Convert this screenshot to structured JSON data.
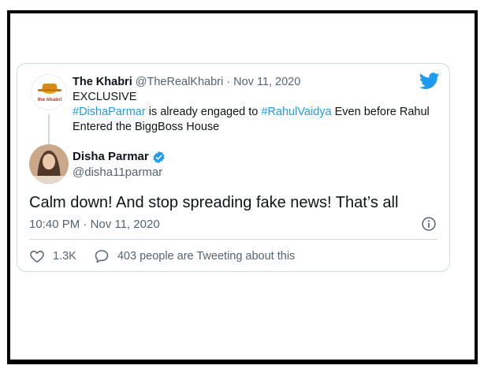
{
  "quoted_tweet": {
    "avatar_text": "the khabri",
    "author_name": "The Khabri",
    "author_handle": "@TheRealKhabri",
    "date": "Nov 11, 2020",
    "line1": "EXCLUSIVE",
    "hashtag1": "#DishaParmar",
    "middle_text": " is already engaged to ",
    "hashtag2": "#RahulVaidya",
    "end_text": " Even before Rahul Entered the BiggBoss House"
  },
  "tweet": {
    "author_name": "Disha Parmar",
    "author_handle": "@disha11parmar",
    "text": "Calm down! And stop spreading fake news! That’s all",
    "time": "10:40 PM",
    "date": "Nov 11, 2020"
  },
  "actions": {
    "likes": "1.3K",
    "replies_text": "403 people are Tweeting about this"
  },
  "colors": {
    "link": "#1d9bf0",
    "muted": "#536471",
    "border": "#cfd9de"
  },
  "icons": [
    "twitter-bird-icon",
    "verified-badge-icon",
    "info-icon",
    "heart-icon",
    "reply-bubble-icon"
  ]
}
